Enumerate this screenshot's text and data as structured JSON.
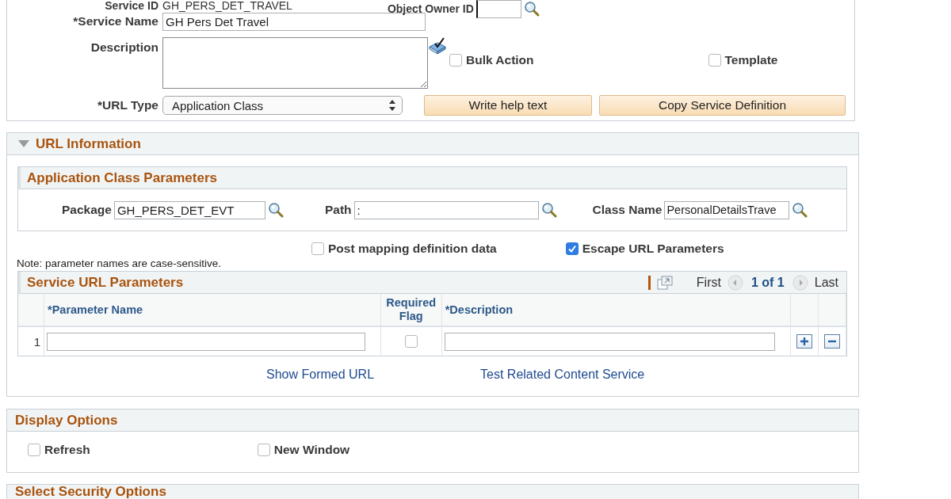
{
  "general": {
    "service_id": {
      "label": "Service ID",
      "value": "GH_PERS_DET_TRAVEL"
    },
    "object_owner": {
      "label": "Object Owner ID"
    },
    "service_name": {
      "label": "*Service Name",
      "value": "GH Pers Det Travel"
    },
    "description": {
      "label": "Description"
    },
    "options": [
      {
        "label": "Bulk Action",
        "checked": false
      },
      {
        "label": "Template",
        "checked": false
      }
    ],
    "url_type": {
      "label": "*URL Type",
      "value": "Application Class"
    },
    "buttons": [
      "Write help text",
      "Copy Service Definition"
    ]
  },
  "url_information": {
    "title": "URL Information",
    "expanded": true,
    "app_class": {
      "title": "Application Class Parameters",
      "fields": [
        {
          "label": "Package",
          "value": "GH_PERS_DET_EVT"
        },
        {
          "label": "Path",
          "value": ":"
        },
        {
          "label": "Class Name",
          "value": "PersonalDetailsTrave"
        }
      ]
    },
    "options": [
      {
        "label": "Post mapping definition data",
        "checked": false
      },
      {
        "label": "Escape URL Parameters",
        "checked": true
      }
    ],
    "note": "Note: parameter names are case-sensitive.",
    "grid": {
      "title": "Service URL Parameters",
      "first": "First",
      "position": "1 of 1",
      "last": "Last",
      "columns": [
        "*Parameter Name",
        "Required Flag",
        "*Description"
      ],
      "rows": [
        {
          "number": "1",
          "required": false
        }
      ]
    },
    "links": [
      "Show Formed URL",
      "Test Related Content Service"
    ]
  },
  "display_options": {
    "title": "Display Options",
    "options": [
      {
        "label": "Refresh",
        "checked": false
      },
      {
        "label": "New Window",
        "checked": false
      }
    ]
  },
  "security": {
    "title": "Select Security Options"
  }
}
